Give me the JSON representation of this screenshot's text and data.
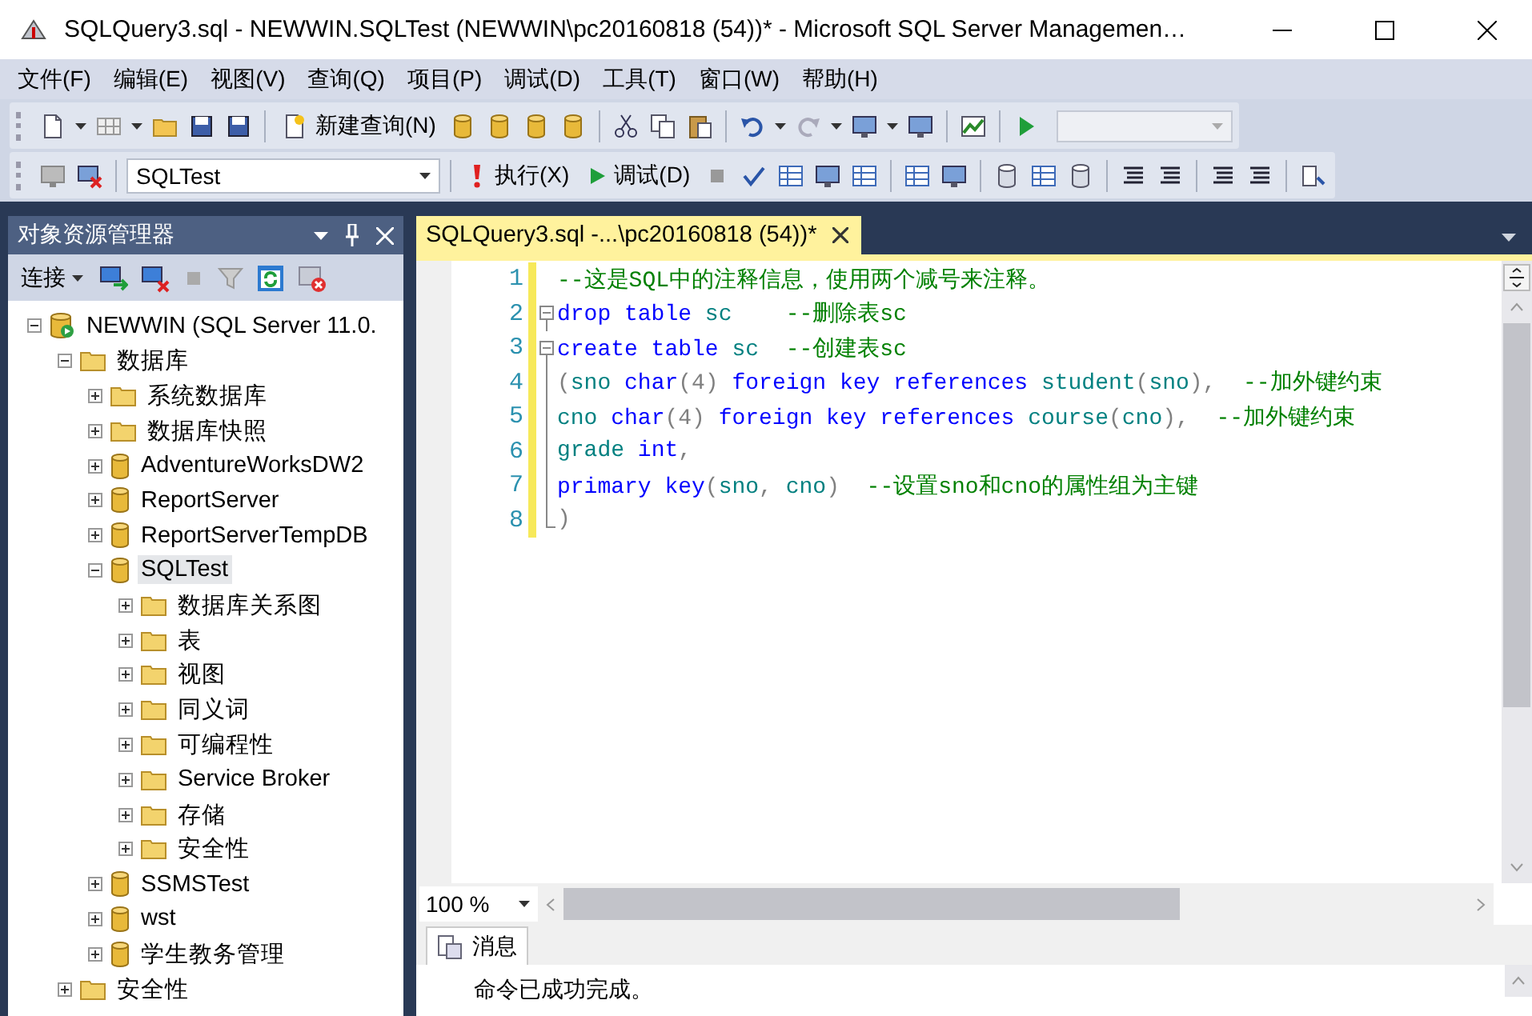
{
  "window": {
    "title": "SQLQuery3.sql - NEWWIN.SQLTest (NEWWIN\\pc20160818 (54))* - Microsoft SQL Server Managemen…"
  },
  "menu": [
    "文件(F)",
    "编辑(E)",
    "视图(V)",
    "查询(Q)",
    "项目(P)",
    "调试(D)",
    "工具(T)",
    "窗口(W)",
    "帮助(H)"
  ],
  "toolbar": {
    "new_query": "新建查询(N)",
    "database": "SQLTest",
    "execute": "执行(X)",
    "debug": "调试(D)"
  },
  "object_explorer": {
    "title": "对象资源管理器",
    "connect": "连接",
    "tree": [
      {
        "label": "NEWWIN (SQL Server 11.0.",
        "kind": "server",
        "expanded": true,
        "selected": false,
        "children": [
          {
            "label": "数据库",
            "kind": "folder",
            "expanded": true,
            "selected": false,
            "children": [
              {
                "label": "系统数据库",
                "kind": "folder",
                "expanded": false,
                "selected": false
              },
              {
                "label": "数据库快照",
                "kind": "folder",
                "expanded": false,
                "selected": false
              },
              {
                "label": "AdventureWorksDW2",
                "kind": "database",
                "expanded": false,
                "selected": false
              },
              {
                "label": "ReportServer",
                "kind": "database",
                "expanded": false,
                "selected": false
              },
              {
                "label": "ReportServerTempDB",
                "kind": "database",
                "expanded": false,
                "selected": false
              },
              {
                "label": "SQLTest",
                "kind": "database",
                "expanded": true,
                "selected": true,
                "children": [
                  {
                    "label": "数据库关系图",
                    "kind": "folder",
                    "expanded": false,
                    "selected": false
                  },
                  {
                    "label": "表",
                    "kind": "folder",
                    "expanded": false,
                    "selected": false
                  },
                  {
                    "label": "视图",
                    "kind": "folder",
                    "expanded": false,
                    "selected": false
                  },
                  {
                    "label": "同义词",
                    "kind": "folder",
                    "expanded": false,
                    "selected": false
                  },
                  {
                    "label": "可编程性",
                    "kind": "folder",
                    "expanded": false,
                    "selected": false
                  },
                  {
                    "label": "Service Broker",
                    "kind": "folder",
                    "expanded": false,
                    "selected": false
                  },
                  {
                    "label": "存储",
                    "kind": "folder",
                    "expanded": false,
                    "selected": false
                  },
                  {
                    "label": "安全性",
                    "kind": "folder",
                    "expanded": false,
                    "selected": false
                  }
                ]
              },
              {
                "label": "SSMSTest",
                "kind": "database",
                "expanded": false,
                "selected": false
              },
              {
                "label": "wst",
                "kind": "database",
                "expanded": false,
                "selected": false
              },
              {
                "label": "学生教务管理",
                "kind": "database",
                "expanded": false,
                "selected": false
              }
            ]
          },
          {
            "label": "安全性",
            "kind": "folder",
            "expanded": false,
            "selected": false
          }
        ]
      }
    ]
  },
  "editor": {
    "tab": "SQLQuery3.sql -...\\pc20160818 (54))*",
    "lines": [
      {
        "number": "1",
        "kind": "plain",
        "tokens": [
          {
            "text": "--这是SQL中的注释信息，使用两个减号来注释。",
            "kind": "comment"
          }
        ]
      },
      {
        "number": "2",
        "kind": "start",
        "tokens": [
          {
            "text": "drop table",
            "kind": "keyword"
          },
          {
            "text": " sc",
            "kind": "ident"
          },
          {
            "text": "    --删除表sc",
            "kind": "comment"
          }
        ]
      },
      {
        "number": "3",
        "kind": "start",
        "tokens": [
          {
            "text": "create table",
            "kind": "keyword"
          },
          {
            "text": " sc",
            "kind": "ident"
          },
          {
            "text": "  --创建表sc",
            "kind": "comment"
          }
        ]
      },
      {
        "number": "4",
        "kind": "body",
        "tokens": [
          {
            "text": "(",
            "kind": "punct"
          },
          {
            "text": "sno ",
            "kind": "ident"
          },
          {
            "text": "char",
            "kind": "keyword"
          },
          {
            "text": "(4) ",
            "kind": "punct"
          },
          {
            "text": "foreign key references ",
            "kind": "keyword"
          },
          {
            "text": "student",
            "kind": "ident"
          },
          {
            "text": "(",
            "kind": "punct"
          },
          {
            "text": "sno",
            "kind": "ident"
          },
          {
            "text": "),",
            "kind": "punct"
          },
          {
            "text": "  --加外键约束",
            "kind": "comment"
          }
        ]
      },
      {
        "number": "5",
        "kind": "body",
        "tokens": [
          {
            "text": "cno ",
            "kind": "ident"
          },
          {
            "text": "char",
            "kind": "keyword"
          },
          {
            "text": "(4) ",
            "kind": "punct"
          },
          {
            "text": "foreign key references ",
            "kind": "keyword"
          },
          {
            "text": "course",
            "kind": "ident"
          },
          {
            "text": "(",
            "kind": "punct"
          },
          {
            "text": "cno",
            "kind": "ident"
          },
          {
            "text": "),",
            "kind": "punct"
          },
          {
            "text": "  --加外键约束",
            "kind": "comment"
          }
        ]
      },
      {
        "number": "6",
        "kind": "body",
        "tokens": [
          {
            "text": "grade ",
            "kind": "ident"
          },
          {
            "text": "int",
            "kind": "keyword"
          },
          {
            "text": ",",
            "kind": "punct"
          }
        ]
      },
      {
        "number": "7",
        "kind": "body",
        "tokens": [
          {
            "text": "primary key",
            "kind": "keyword"
          },
          {
            "text": "(",
            "kind": "punct"
          },
          {
            "text": "sno",
            "kind": "ident"
          },
          {
            "text": ", ",
            "kind": "punct"
          },
          {
            "text": "cno",
            "kind": "ident"
          },
          {
            "text": ")",
            "kind": "punct"
          },
          {
            "text": "  --设置sno和cno的属性组为主键",
            "kind": "comment"
          }
        ]
      },
      {
        "number": "8",
        "kind": "end",
        "tokens": [
          {
            "text": ")",
            "kind": "punct"
          }
        ]
      }
    ],
    "zoom": "100 %"
  },
  "results": {
    "tab": "消息",
    "message": "命令已成功完成。"
  }
}
